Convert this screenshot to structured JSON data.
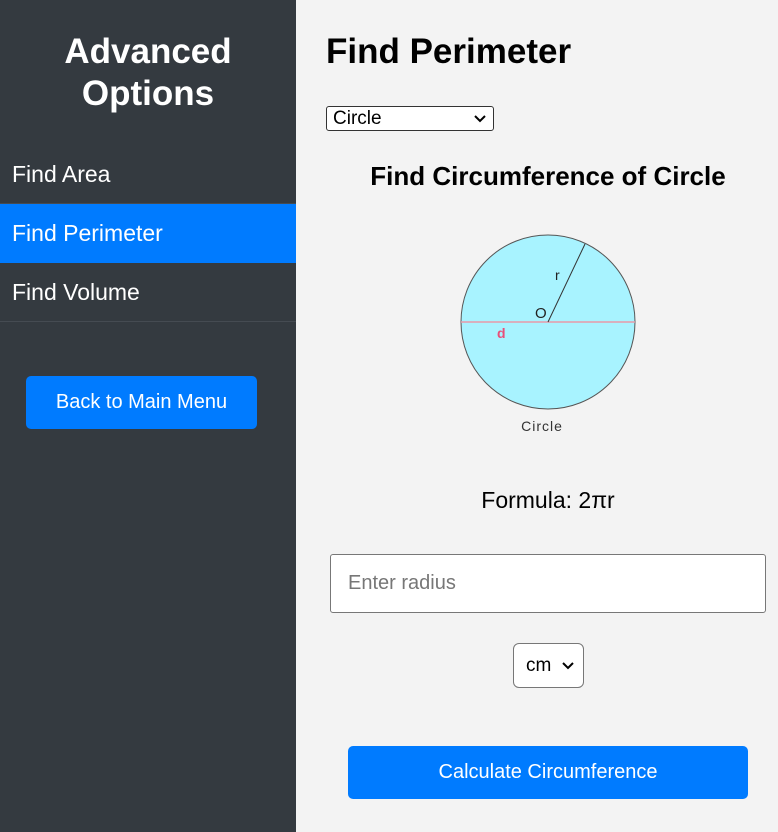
{
  "sidebar": {
    "title_line1": "Advanced",
    "title_line2": "Options",
    "items": [
      {
        "label": "Find Area",
        "active": false
      },
      {
        "label": "Find Perimeter",
        "active": true
      },
      {
        "label": "Find Volume",
        "active": false
      }
    ],
    "back_label": "Back to Main Menu"
  },
  "main": {
    "title": "Find Perimeter",
    "shape_select": {
      "value": "Circle"
    },
    "subtitle": "Find Circumference of Circle",
    "diagram": {
      "label_r": "r",
      "label_o": "O",
      "label_d": "d",
      "caption": "Circle"
    },
    "formula": "Formula: 2πr",
    "radius_input": {
      "placeholder": "Enter radius",
      "value": ""
    },
    "unit_select": {
      "value": "cm"
    },
    "calculate_label": "Calculate Circumference"
  },
  "colors": {
    "sidebar_bg": "#343a40",
    "accent": "#007bff",
    "circle_fill": "#a8f3ff",
    "diameter_label": "#e8507a"
  }
}
